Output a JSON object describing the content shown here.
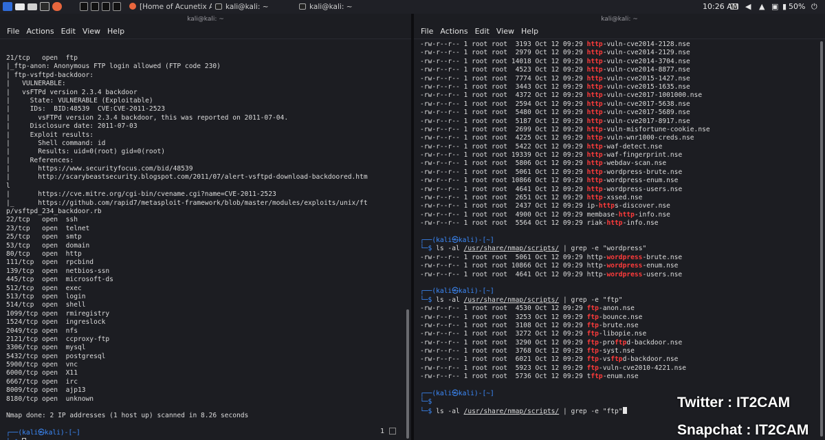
{
  "taskbar": {
    "tasks": [
      {
        "label": "[Home of Acunetix Art -",
        "icon": "firefox-icon"
      },
      {
        "label": "kali@kali: ~",
        "icon": "terminal-icon"
      },
      {
        "label": "kali@kali: ~",
        "icon": "terminal-icon"
      }
    ],
    "clock": "10:26 AM",
    "battery": "50%"
  },
  "left_terminal": {
    "title": "kali@kali: ~",
    "menu": [
      "File",
      "Actions",
      "Edit",
      "View",
      "Help"
    ],
    "lines": [
      "21/tcp   open  ftp",
      "|_ftp-anon: Anonymous FTP login allowed (FTP code 230)",
      "| ftp-vsftpd-backdoor:",
      "|   VULNERABLE:",
      "|   vsFTPd version 2.3.4 backdoor",
      "|     State: VULNERABLE (Exploitable)",
      "|     IDs:  BID:48539  CVE:CVE-2011-2523",
      "|       vsFTPd version 2.3.4 backdoor, this was reported on 2011-07-04.",
      "|     Disclosure date: 2011-07-03",
      "|     Exploit results:",
      "|       Shell command: id",
      "|       Results: uid=0(root) gid=0(root)",
      "|     References:",
      "|       https://www.securityfocus.com/bid/48539",
      "|       http://scarybeastsecurity.blogspot.com/2011/07/alert-vsftpd-download-backdoored.htm",
      "l",
      "|       https://cve.mitre.org/cgi-bin/cvename.cgi?name=CVE-2011-2523",
      "|_      https://github.com/rapid7/metasploit-framework/blob/master/modules/exploits/unix/ft",
      "p/vsftpd_234_backdoor.rb",
      "22/tcp   open  ssh",
      "23/tcp   open  telnet",
      "25/tcp   open  smtp",
      "53/tcp   open  domain",
      "80/tcp   open  http",
      "111/tcp  open  rpcbind",
      "139/tcp  open  netbios-ssn",
      "445/tcp  open  microsoft-ds",
      "512/tcp  open  exec",
      "513/tcp  open  login",
      "514/tcp  open  shell",
      "1099/tcp open  rmiregistry",
      "1524/tcp open  ingreslock",
      "2049/tcp open  nfs",
      "2121/tcp open  ccproxy-ftp",
      "3306/tcp open  mysql",
      "5432/tcp open  postgresql",
      "5900/tcp open  vnc",
      "6000/tcp open  X11",
      "6667/tcp open  irc",
      "8009/tcp open  ajp13",
      "8180/tcp open  unknown",
      "",
      "Nmap done: 2 IP addresses (1 host up) scanned in 8.26 seconds",
      ""
    ],
    "prompt_top": "┌──(kali㉿kali)-[~]",
    "prompt_bottom": "└─$ ",
    "tab_number": "1"
  },
  "right_terminal": {
    "title": "kali@kali: ~",
    "menu": [
      "File",
      "Actions",
      "Edit",
      "View",
      "Help"
    ],
    "block1": [
      [
        "-rw-r--r-- 1 root root  3193 Oct 12 09:29 ",
        "http",
        "-vuln-cve2014-2128.nse"
      ],
      [
        "-rw-r--r-- 1 root root  2979 Oct 12 09:29 ",
        "http",
        "-vuln-cve2014-2129.nse"
      ],
      [
        "-rw-r--r-- 1 root root 14018 Oct 12 09:29 ",
        "http",
        "-vuln-cve2014-3704.nse"
      ],
      [
        "-rw-r--r-- 1 root root  4523 Oct 12 09:29 ",
        "http",
        "-vuln-cve2014-8877.nse"
      ],
      [
        "-rw-r--r-- 1 root root  7774 Oct 12 09:29 ",
        "http",
        "-vuln-cve2015-1427.nse"
      ],
      [
        "-rw-r--r-- 1 root root  3443 Oct 12 09:29 ",
        "http",
        "-vuln-cve2015-1635.nse"
      ],
      [
        "-rw-r--r-- 1 root root  4372 Oct 12 09:29 ",
        "http",
        "-vuln-cve2017-1001000.nse"
      ],
      [
        "-rw-r--r-- 1 root root  2594 Oct 12 09:29 ",
        "http",
        "-vuln-cve2017-5638.nse"
      ],
      [
        "-rw-r--r-- 1 root root  5480 Oct 12 09:29 ",
        "http",
        "-vuln-cve2017-5689.nse"
      ],
      [
        "-rw-r--r-- 1 root root  5187 Oct 12 09:29 ",
        "http",
        "-vuln-cve2017-8917.nse"
      ],
      [
        "-rw-r--r-- 1 root root  2699 Oct 12 09:29 ",
        "http",
        "-vuln-misfortune-cookie.nse"
      ],
      [
        "-rw-r--r-- 1 root root  4225 Oct 12 09:29 ",
        "http",
        "-vuln-wnr1000-creds.nse"
      ],
      [
        "-rw-r--r-- 1 root root  5422 Oct 12 09:29 ",
        "http",
        "-waf-detect.nse"
      ],
      [
        "-rw-r--r-- 1 root root 19339 Oct 12 09:29 ",
        "http",
        "-waf-fingerprint.nse"
      ],
      [
        "-rw-r--r-- 1 root root  5806 Oct 12 09:29 ",
        "http",
        "-webdav-scan.nse"
      ],
      [
        "-rw-r--r-- 1 root root  5061 Oct 12 09:29 ",
        "http",
        "-wordpress-brute.nse"
      ],
      [
        "-rw-r--r-- 1 root root 10866 Oct 12 09:29 ",
        "http",
        "-wordpress-enum.nse"
      ],
      [
        "-rw-r--r-- 1 root root  4641 Oct 12 09:29 ",
        "http",
        "-wordpress-users.nse"
      ],
      [
        "-rw-r--r-- 1 root root  2651 Oct 12 09:29 ",
        "http",
        "-xssed.nse"
      ],
      [
        "-rw-r--r-- 1 root root  2437 Oct 12 09:29 ip-",
        "http",
        "s-discover.nse"
      ],
      [
        "-rw-r--r-- 1 root root  4900 Oct 12 09:29 membase-",
        "http",
        "-info.nse"
      ],
      [
        "-rw-r--r-- 1 root root  5564 Oct 12 09:29 riak-",
        "http",
        "-info.nse"
      ]
    ],
    "prompt_top": "┌──(kali㉿kali)-[~]",
    "prompt_arrow": "└─$ ",
    "cmd1": {
      "pre": "ls -al ",
      "path": "/usr/share/nmap/scripts/",
      "post": " | grep -e \"wordpress\""
    },
    "block2": [
      [
        "-rw-r--r-- 1 root root  5061 Oct 12 09:29 http-",
        "wordpress",
        "-brute.nse"
      ],
      [
        "-rw-r--r-- 1 root root 10866 Oct 12 09:29 http-",
        "wordpress",
        "-enum.nse"
      ],
      [
        "-rw-r--r-- 1 root root  4641 Oct 12 09:29 http-",
        "wordpress",
        "-users.nse"
      ]
    ],
    "cmd2": {
      "pre": "ls -al ",
      "path": "/usr/share/nmap/scripts/",
      "post": " | grep -e \"ftp\""
    },
    "block3": [
      [
        "-rw-r--r-- 1 root root  4530 Oct 12 09:29 ",
        "ftp",
        "-anon.nse"
      ],
      [
        "-rw-r--r-- 1 root root  3253 Oct 12 09:29 ",
        "ftp",
        "-bounce.nse"
      ],
      [
        "-rw-r--r-- 1 root root  3108 Oct 12 09:29 ",
        "ftp",
        "-brute.nse"
      ],
      [
        "-rw-r--r-- 1 root root  3272 Oct 12 09:29 ",
        "ftp",
        "-libopie.nse"
      ],
      [
        "-rw-r--r-- 1 root root  3290 Oct 12 09:29 ",
        "ftp",
        "-pro",
        "ftp",
        "d-backdoor.nse"
      ],
      [
        "-rw-r--r-- 1 root root  3768 Oct 12 09:29 ",
        "ftp",
        "-syst.nse"
      ],
      [
        "-rw-r--r-- 1 root root  6021 Oct 12 09:29 ",
        "ftp",
        "-vs",
        "ftp",
        "d-backdoor.nse"
      ],
      [
        "-rw-r--r-- 1 root root  5923 Oct 12 09:29 ",
        "ftp",
        "-vuln-cve2010-4221.nse"
      ],
      [
        "-rw-r--r-- 1 root root  5736 Oct 12 09:29 t",
        "ftp",
        "-enum.nse"
      ]
    ],
    "cmd3": {
      "pre": "ls -al ",
      "path": "/usr/share/nmap/scripts/",
      "post": " | grep -e \"ftp\""
    }
  },
  "watermarks": {
    "twitter": "Twitter : IT2CAM",
    "snapchat": "Snapchat : IT2CAM"
  },
  "colors": {
    "highlight": "#ff3b3b",
    "prompt": "#3c8cff",
    "background": "#1c1d22"
  }
}
